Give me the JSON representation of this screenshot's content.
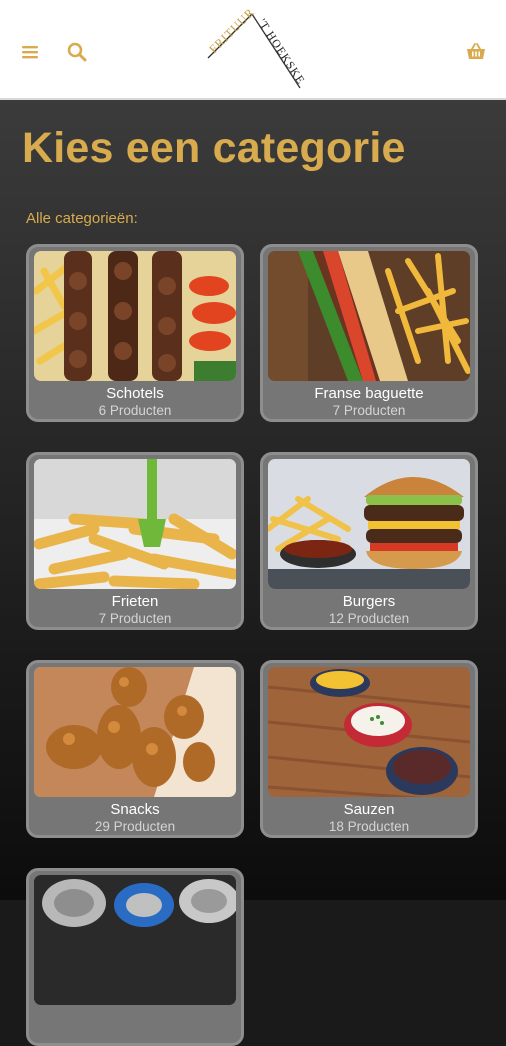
{
  "header": {
    "menu_icon": "hamburger-menu-icon",
    "search_icon": "search-icon",
    "cart_icon": "shopping-basket-icon",
    "logo_text_left": "FRITUUR",
    "logo_text_right": "'T HOEKSKE",
    "accent_color": "#d8ab4e"
  },
  "main": {
    "title": "Kies een categorie",
    "section_label": "Alle categorieën:"
  },
  "categories": [
    {
      "name": "Schotels",
      "count": "6 Producten"
    },
    {
      "name": "Franse baguette",
      "count": "7 Producten"
    },
    {
      "name": "Frieten",
      "count": "7 Producten"
    },
    {
      "name": "Burgers",
      "count": "12 Producten"
    },
    {
      "name": "Snacks",
      "count": "29 Producten"
    },
    {
      "name": "Sauzen",
      "count": "18 Producten"
    },
    {
      "name": "",
      "count": ""
    }
  ]
}
